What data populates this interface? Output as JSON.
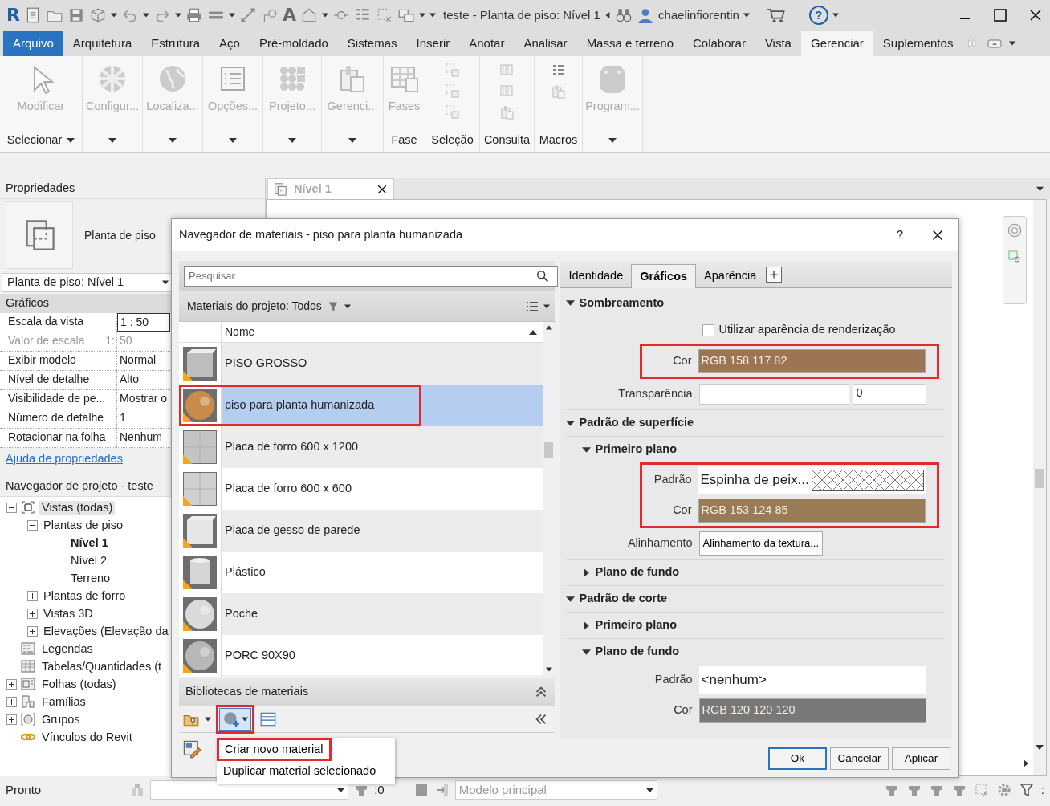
{
  "title_bar": {
    "logo": "R",
    "text_tool": "A",
    "title": "teste - Planta de piso: Nível 1",
    "user": "chaelinfiorentin",
    "help": "?"
  },
  "ribbon_tabs": [
    {
      "label": "Arquivo",
      "kind": "application",
      "selected": false
    },
    {
      "label": "Arquitetura",
      "kind": "tab",
      "selected": false
    },
    {
      "label": "Estrutura",
      "kind": "tab",
      "selected": false
    },
    {
      "label": "Aço",
      "kind": "tab",
      "selected": false
    },
    {
      "label": "Pré-moldado",
      "kind": "tab",
      "selected": false
    },
    {
      "label": "Sistemas",
      "kind": "tab",
      "selected": false
    },
    {
      "label": "Inserir",
      "kind": "tab",
      "selected": false
    },
    {
      "label": "Anotar",
      "kind": "tab",
      "selected": false
    },
    {
      "label": "Analisar",
      "kind": "tab",
      "selected": false
    },
    {
      "label": "Massa e terreno",
      "kind": "tab",
      "selected": false
    },
    {
      "label": "Colaborar",
      "kind": "tab",
      "selected": false
    },
    {
      "label": "Vista",
      "kind": "tab",
      "selected": false
    },
    {
      "label": "Gerenciar",
      "kind": "tab",
      "selected": true
    },
    {
      "label": "Suplementos",
      "kind": "tab",
      "selected": false
    }
  ],
  "ribbon_panels": [
    {
      "label": "Modificar",
      "title": "Selecionar",
      "dropdown": true
    },
    {
      "label": "Configur...",
      "dropdown": true
    },
    {
      "label": "Localiza...",
      "dropdown": true
    },
    {
      "label": "Opções...",
      "dropdown": true
    },
    {
      "label": "Projeto...",
      "dropdown": true
    },
    {
      "label": "Gerenci...",
      "dropdown": true
    },
    {
      "label": "Fases",
      "title": "Fase",
      "dropdown": false
    },
    {
      "title": "Seleção",
      "dropdown": false
    },
    {
      "title": "Consulta",
      "dropdown": false
    },
    {
      "title": "Macros",
      "dropdown": false
    },
    {
      "label": "Program...",
      "dropdown": true
    }
  ],
  "properties": {
    "title": "Propriedades",
    "type_name": "Planta de piso",
    "selector": "Planta de piso: Nível 1",
    "group": "Gráficos",
    "rows": [
      {
        "name": "Escala da vista",
        "value": "1 : 50",
        "kind": "input",
        "disabled": false
      },
      {
        "name": "Valor de escala",
        "unit": "1:",
        "value": "50",
        "kind": "text",
        "disabled": true
      },
      {
        "name": "Exibir modelo",
        "value": "Normal",
        "kind": "text",
        "disabled": false
      },
      {
        "name": "Nível de detalhe",
        "value": "Alto",
        "kind": "text",
        "disabled": false
      },
      {
        "name": "Visibilidade de pe...",
        "value": "Mostrar o",
        "kind": "text",
        "disabled": false
      },
      {
        "name": "Número de detalhe",
        "value": "1",
        "kind": "text",
        "disabled": false
      },
      {
        "name": "Rotacionar na folha",
        "value": "Nenhum",
        "kind": "text",
        "disabled": false
      }
    ],
    "help_link": "Ajuda de propriedades"
  },
  "project_browser": {
    "title": "Navegador de projeto - teste",
    "tree": [
      {
        "label": "Vistas (todas)",
        "expanded": true,
        "selected": true,
        "children": [
          {
            "label": "Plantas de piso",
            "expanded": true,
            "selected": false,
            "children": [
              {
                "label": "Nível 1",
                "current": true,
                "selected": false
              },
              {
                "label": "Nível 2",
                "current": false,
                "selected": false
              },
              {
                "label": "Terreno",
                "current": false,
                "selected": false
              }
            ]
          },
          {
            "label": "Plantas de forro",
            "expanded": false,
            "selected": false
          },
          {
            "label": "Vistas 3D",
            "expanded": false,
            "selected": false
          },
          {
            "label": "Elevações (Elevação da",
            "expanded": false,
            "selected": false
          }
        ]
      },
      {
        "label": "Legendas",
        "selected": false
      },
      {
        "label": "Tabelas/Quantidades (t",
        "selected": false
      },
      {
        "label": "Folhas (todas)",
        "expanded": false,
        "selected": false
      },
      {
        "label": "Famílias",
        "expanded": false,
        "selected": false
      },
      {
        "label": "Grupos",
        "expanded": false,
        "selected": false
      },
      {
        "label": "Vínculos do Revit",
        "selected": false
      }
    ]
  },
  "view_tab": {
    "label": "Nível 1"
  },
  "material_dialog": {
    "title": "Navegador de materiais - piso para planta humanizada",
    "help": "?",
    "search": {
      "placeholder": "Pesquisar"
    },
    "filter": "Materiais do projeto: Todos",
    "column": "Nome",
    "materials": [
      {
        "name": "PISO GROSSO",
        "selected": false,
        "marked": false
      },
      {
        "name": "piso para planta humanizada",
        "selected": true,
        "marked": true
      },
      {
        "name": "Placa de forro 600 x 1200",
        "selected": false,
        "marked": false
      },
      {
        "name": "Placa de forro 600 x 600",
        "selected": false,
        "marked": false
      },
      {
        "name": "Placa de gesso de parede",
        "selected": false,
        "marked": false
      },
      {
        "name": "Plástico",
        "selected": false,
        "marked": false
      },
      {
        "name": "Poche",
        "selected": false,
        "marked": false
      },
      {
        "name": "PORC 90X90",
        "selected": false,
        "marked": false
      }
    ],
    "libraries": "Bibliotecas de materiais",
    "create_button_marked": true,
    "menu": [
      {
        "label": "Criar novo material",
        "marked": true
      },
      {
        "label": "Duplicar material selecionado",
        "marked": false
      }
    ],
    "tabs": [
      {
        "label": "Identidade",
        "selected": false
      },
      {
        "label": "Gráficos",
        "selected": true
      },
      {
        "label": "Aparência",
        "selected": false
      }
    ],
    "rows": [
      {
        "kind": "section",
        "title": "Sombreamento",
        "expanded": true
      },
      {
        "kind": "checkbox",
        "label": "Utilizar aparência de renderização",
        "checked": false
      },
      {
        "kind": "group",
        "marked": true,
        "rows": [
          {
            "kind": "color",
            "label": "Cor",
            "value": "RGB 158 117 82",
            "color": "#9e7552"
          }
        ]
      },
      {
        "kind": "transparency",
        "label": "Transparência",
        "value": "0"
      },
      {
        "kind": "section",
        "title": "Padrão de superfície",
        "expanded": true
      },
      {
        "kind": "subsection",
        "title": "Primeiro plano",
        "expanded": true
      },
      {
        "kind": "group",
        "marked": true,
        "rows": [
          {
            "kind": "pattern",
            "label": "Padrão",
            "value": "Espinha de peix...",
            "hatch": true
          },
          {
            "kind": "color",
            "label": "Cor",
            "value": "RGB 153 124 85",
            "color": "#997c55"
          }
        ]
      },
      {
        "kind": "button",
        "label": "Alinhamento",
        "value": "Alinhamento da textura..."
      },
      {
        "kind": "subsection",
        "title": "Plano de fundo",
        "expanded": false
      },
      {
        "kind": "section",
        "title": "Padrão de corte",
        "expanded": true
      },
      {
        "kind": "subsection",
        "title": "Primeiro plano",
        "expanded": false
      },
      {
        "kind": "subsection",
        "title": "Plano de fundo",
        "expanded": true
      },
      {
        "kind": "pattern",
        "label": "Padrão",
        "value": "<nenhum>",
        "hatch": false
      },
      {
        "kind": "color",
        "label": "Cor",
        "value": "RGB 120 120 120",
        "color": "#787878"
      }
    ],
    "buttons": [
      {
        "label": "Ok",
        "default": true
      },
      {
        "label": "Cancelar",
        "default": false
      },
      {
        "label": "Aplicar",
        "default": false
      }
    ]
  },
  "status_bar": {
    "message": "Pronto",
    "worksets": ":0",
    "model": "Modelo principal",
    "filter": ":"
  }
}
